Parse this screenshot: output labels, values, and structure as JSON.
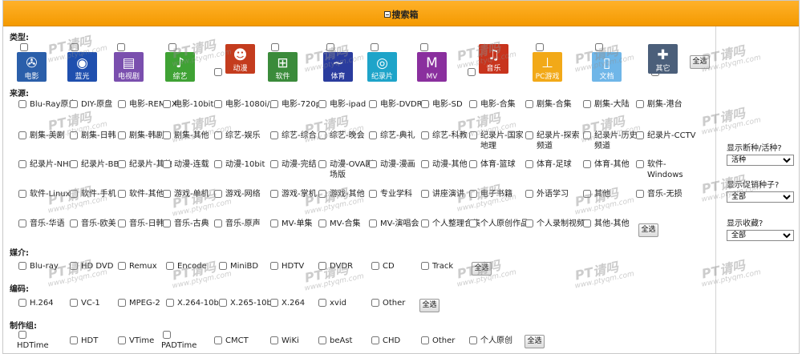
{
  "header": {
    "title": "搜索箱"
  },
  "sections": {
    "type": "类型:",
    "source": "来源:",
    "media": "媒介:",
    "codec": "编码:",
    "group": "制作组:"
  },
  "select_all": "全选",
  "categories": [
    {
      "label": "电影",
      "icon": "film-reel-icon",
      "glyph": "✇",
      "color": "#2b5faa"
    },
    {
      "label": "蓝光",
      "icon": "bluray-icon",
      "glyph": "◉",
      "color": "#1f4fae"
    },
    {
      "label": "电视剧",
      "icon": "clapper-icon",
      "glyph": "▤",
      "color": "#7a4fae"
    },
    {
      "label": "综艺",
      "icon": "microphone-icon",
      "glyph": "♪",
      "color": "#3fa234"
    },
    {
      "label": "动漫",
      "icon": "anime-icon",
      "glyph": "☻",
      "color": "#c43c1e"
    },
    {
      "label": "软件",
      "icon": "windows-icon",
      "glyph": "⊞",
      "color": "#3b8b3b"
    },
    {
      "label": "体育",
      "icon": "sports-icon",
      "glyph": "~",
      "color": "#2a3c9e"
    },
    {
      "label": "纪录片",
      "icon": "projector-icon",
      "glyph": "◎",
      "color": "#1ea4c9"
    },
    {
      "label": "MV",
      "icon": "mtv-icon",
      "glyph": "M",
      "color": "#8a2f9e"
    },
    {
      "label": "音乐",
      "icon": "music-note-icon",
      "glyph": "♫",
      "color": "#c8341d"
    },
    {
      "label": "PC游戏",
      "icon": "joystick-icon",
      "glyph": "⊥",
      "color": "#f2a918"
    },
    {
      "label": "文档",
      "icon": "document-icon",
      "glyph": "▯",
      "color": "#6fb6e8"
    },
    {
      "label": "其它",
      "icon": "plus-icon",
      "glyph": "✚",
      "color": "#4b5f7a"
    }
  ],
  "sources": [
    [
      "Blu-Ray原盘",
      "DIY-原盘",
      "电影-REMUX",
      "电影-10bit",
      "电影-1080i/p",
      "电影-720p",
      "电影-ipad",
      "电影-DVDRip",
      "电影-SD",
      "电影-合集",
      "剧集-合集",
      "剧集-大陆",
      "剧集-港台"
    ],
    [
      "剧集-美剧",
      "剧集-日韩",
      "剧集-韩剧",
      "剧集-其他",
      "综艺-娱乐",
      "综艺-综合",
      "综艺-晚会",
      "综艺-典礼",
      "综艺-科教",
      "纪录片-国家地理",
      "纪录片-探索频道",
      "纪录片-历史频道",
      "纪录片-CCTV"
    ],
    [
      "纪录片-NHK",
      "纪录片-BBC",
      "纪录片-其他",
      "动漫-连载",
      "动漫-10bit",
      "动漫-完结",
      "动漫-OVA剧场版",
      "动漫-漫画",
      "动漫-其他",
      "体育-篮球",
      "体育-足球",
      "体育-其他",
      "软件-Windows"
    ],
    [
      "软件-Linux",
      "软件-手机",
      "软件-其他",
      "游戏-单机",
      "游戏-网络",
      "游戏-掌机",
      "游戏-其他",
      "专业学科",
      "讲座演讲",
      "电子书籍",
      "外语学习",
      "其他",
      "音乐-无损"
    ],
    [
      "音乐-华语",
      "音乐-欧美",
      "音乐-日韩",
      "音乐-古典",
      "音乐-原声",
      "MV-单集",
      "MV-合集",
      "MV-演唱会",
      "个人整理合集",
      "个人原创作品",
      "个人录制视频",
      "其他-其他",
      ""
    ]
  ],
  "media": [
    "Blu-ray",
    "HD DVD",
    "Remux",
    "Encode",
    "MiniBD",
    "HDTV",
    "DVDR",
    "CD",
    "Track"
  ],
  "codecs": [
    "H.264",
    "VC-1",
    "MPEG-2",
    "X.264-10bit",
    "X.265-10bit",
    "X.264",
    "xvid",
    "Other"
  ],
  "groups": [
    "HDTime",
    "HDT",
    "VTime",
    "PADTime",
    "CMCT",
    "WiKi",
    "beAst",
    "CHD",
    "Other",
    "个人原创"
  ],
  "sidebar": {
    "dead_label": "显示断种/活种?",
    "dead_value": "活种",
    "promo_label": "显示促销种子?",
    "promo_value": "全部",
    "fav_label": "显示收藏?",
    "fav_value": "全部"
  },
  "watermark": {
    "main": "PT请吗",
    "sub": "www.ptyqm.com"
  }
}
